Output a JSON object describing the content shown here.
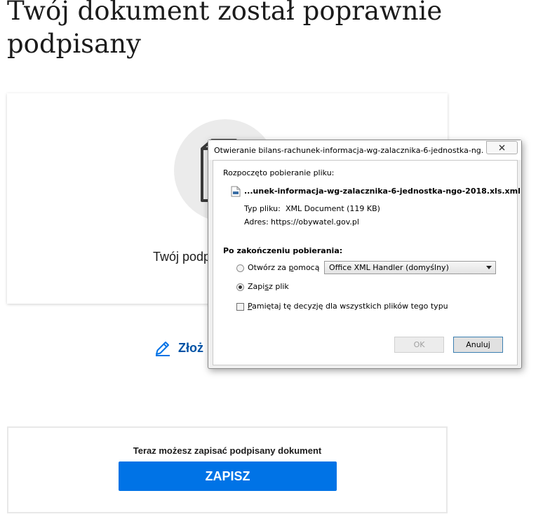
{
  "page": {
    "title": "Twój dokument został poprawnie podpisany",
    "card_text": "Twój podp",
    "sign_link": "Złoż",
    "save_prompt": "Teraz możesz zapisać podpisany dokument",
    "save_button": "ZAPISZ"
  },
  "dialog": {
    "title": "Otwieranie bilans-rachunek-informacja-wg-zalacznika-6-jednostka-ng...",
    "started_label": "Rozpoczęto pobieranie pliku:",
    "file_name": "...unek-informacja-wg-zalacznika-6-jednostka-ngo-2018.xls.xml",
    "type_label": "Typ pliku:",
    "type_value": "XML Document (119 KB)",
    "address_label": "Adres:",
    "address_value": "https://obywatel.gov.pl",
    "after_download_label": "Po zakończeniu pobierania:",
    "open_with_pre": "Otwórz za ",
    "open_with_u": "p",
    "open_with_post": "omocą",
    "handler_selected": "Office XML Handler (domyślny)",
    "save_pre": "Zapi",
    "save_u": "s",
    "save_post": "z plik",
    "remember_pre": "",
    "remember_u": "P",
    "remember_post": "amiętaj tę decyzję dla wszystkich plików tego typu",
    "ok_label": "OK",
    "cancel_label": "Anuluj",
    "selected_option": "save",
    "remember_checked": false
  },
  "colors": {
    "accent_blue": "#0073e6",
    "link_blue": "#0052a5"
  },
  "icons": {
    "document": "document-icon",
    "pencil": "pencil-icon",
    "xml_file": "xml-file-icon",
    "close": "close-icon",
    "dropdown": "chevron-down-icon"
  }
}
